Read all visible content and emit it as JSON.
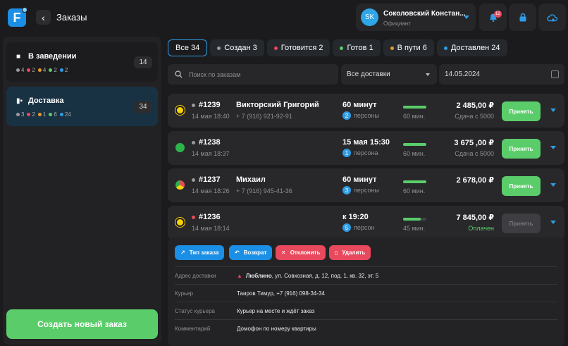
{
  "header": {
    "logo": "F",
    "title": "Заказы"
  },
  "user": {
    "initials": "SK",
    "name": "Соколовский Констан...",
    "role": "Официант"
  },
  "notifications": {
    "count": "12"
  },
  "sidebar": {
    "cards": [
      {
        "label": "В заведении",
        "count": "14",
        "stats": [
          "4",
          "2",
          "4",
          "2",
          "2"
        ]
      },
      {
        "label": "Доставка",
        "count": "34",
        "stats": [
          "3",
          "2",
          "1",
          "6",
          "24"
        ]
      }
    ],
    "create_button": "Создать новый заказ"
  },
  "status_colors": [
    "#9a9a9f",
    "#e8495c",
    "#e89a2f",
    "#5acd6a",
    "#2f9ce5"
  ],
  "tabs": [
    {
      "label": "Все 34"
    },
    {
      "label": "Создан 3"
    },
    {
      "label": "Готовится 2"
    },
    {
      "label": "Готов 1"
    },
    {
      "label": "В пути 6"
    },
    {
      "label": "Доставлен 24"
    }
  ],
  "filters": {
    "search_placeholder": "Поиск по заказам",
    "delivery_select": "Все доставки",
    "date": "14.05.2024"
  },
  "orders": [
    {
      "number": "#1239",
      "date": "14 мая 18:40",
      "customer": "Викторский Григорий",
      "phone": "+ 7 (916) 921-92-91",
      "time": "60 минут",
      "persons_count": "2",
      "persons_label": "персоны",
      "progress": 1.0,
      "minutes": "60 мин.",
      "price": "2 485,00 ₽",
      "change": "Сдача с 5000",
      "action": "Принять"
    },
    {
      "number": "#1238",
      "date": "14 мая 18:37",
      "customer": "",
      "phone": "",
      "time": "15 мая 15:30",
      "persons_count": "1",
      "persons_label": "персона",
      "progress": 1.0,
      "minutes": "60 мин.",
      "price": "3 675 ,00 ₽",
      "change": "Сдача с 5000",
      "action": "Принять"
    },
    {
      "number": "#1237",
      "date": "14 мая 18:26",
      "customer": "Михаил",
      "phone": "+ 7 (916) 945-41-36",
      "time": "60 минут",
      "persons_count": "3",
      "persons_label": "персоны",
      "progress": 1.0,
      "minutes": "60 мин.",
      "price": "2 678,00 ₽",
      "change": "",
      "action": "Принять"
    },
    {
      "number": "#1236",
      "date": "14 мая 18:14",
      "customer": "",
      "phone": "",
      "time": "к 19:20",
      "persons_count": "5",
      "persons_label": "персон",
      "progress": 0.75,
      "minutes": "45 мин.",
      "price": "7 845,00 ₽",
      "change": "Оплачен",
      "action": "Принять"
    }
  ],
  "detail": {
    "actions": [
      {
        "label": "Тип заказа",
        "color": "#1b8fe6"
      },
      {
        "label": "Возврат",
        "color": "#1b8fe6"
      },
      {
        "label": "Отклонить",
        "color": "#e8495c"
      },
      {
        "label": "Удалить",
        "color": "#e8495c"
      }
    ],
    "rows": [
      {
        "key": "Адрес доставки",
        "value_bold": "Люблино",
        "value": ", ул. Совхозная, д. 12,  под. 1, кв. 32, эт. 5"
      },
      {
        "key": "Курьер",
        "value": "Таиров Тимур, +7 (916) 098-34-34"
      },
      {
        "key": "Статус курьера",
        "value": "Курьер на месте и ждёт заказ"
      },
      {
        "key": "Комментарий",
        "value": "Домофон по номеру квартиры"
      }
    ]
  }
}
